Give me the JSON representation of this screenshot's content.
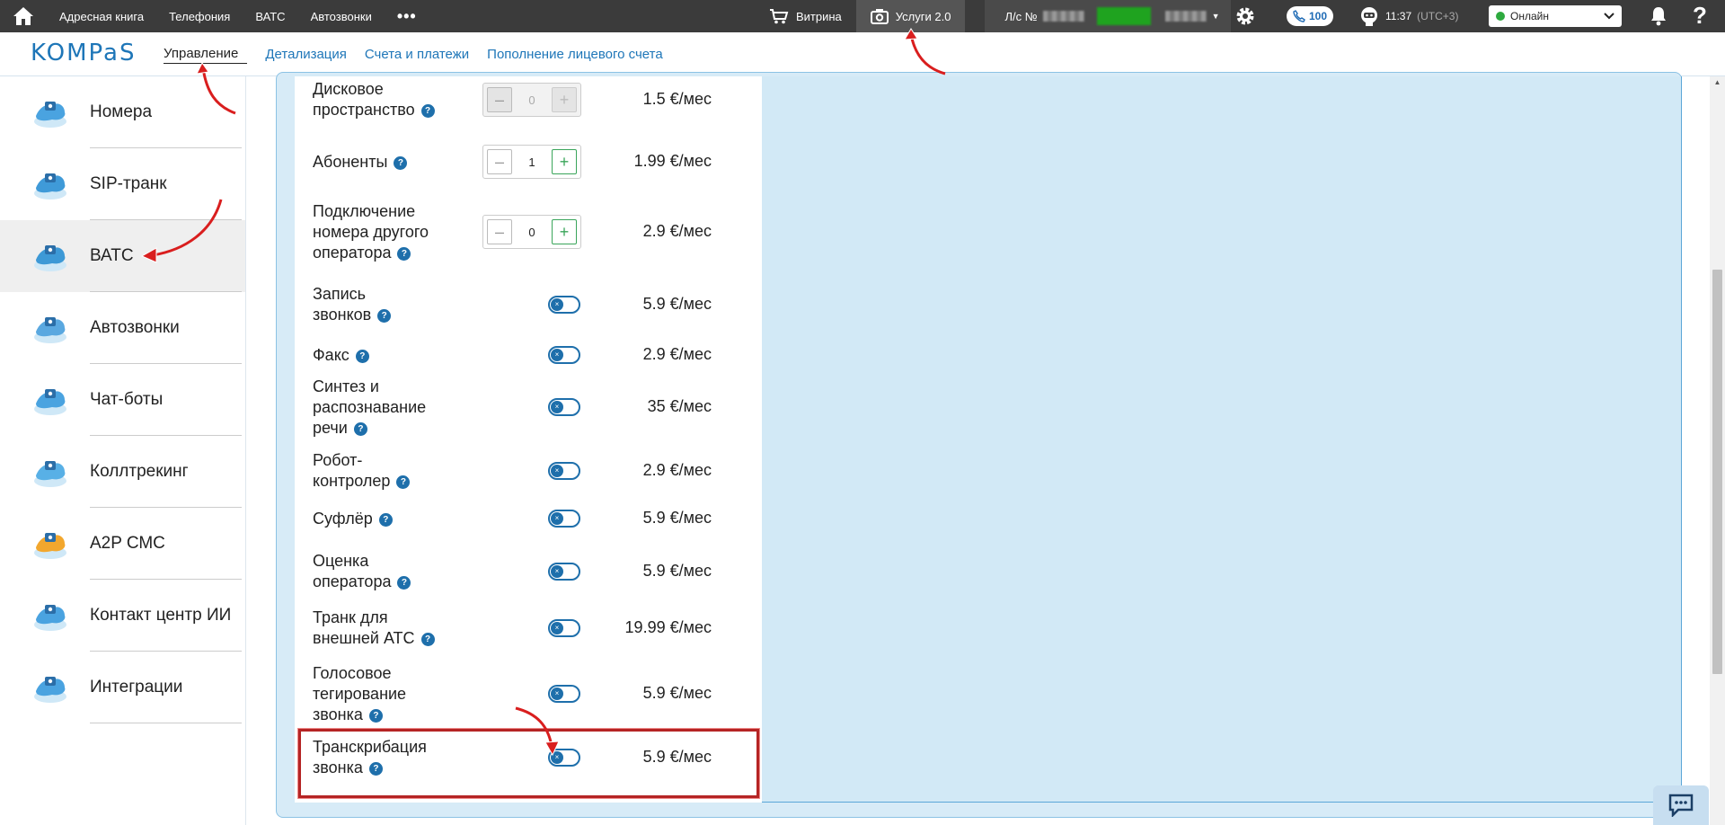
{
  "topbar": {
    "nav": [
      "Адресная книга",
      "Телефония",
      "ВАТС",
      "Автозвонки"
    ],
    "more": "•••",
    "vitrina": "Витрина",
    "services": "Услуги 2.0",
    "account_prefix": "Л/с №",
    "calls_count": "100",
    "time": "11:37",
    "timezone": "(UTC+3)",
    "status": "Онлайн",
    "help": "?"
  },
  "subheader": {
    "logo": "KOMPaS",
    "tabs": [
      "Управление",
      "Детализация",
      "Счета и платежи",
      "Пополнение лицевого счета"
    ]
  },
  "sidebar": {
    "items": [
      {
        "label": "Номера"
      },
      {
        "label": "SIP-транк"
      },
      {
        "label": "ВАТС"
      },
      {
        "label": "Автозвонки"
      },
      {
        "label": "Чат-боты"
      },
      {
        "label": "Коллтрекинг"
      },
      {
        "label": "A2P СМС"
      },
      {
        "label": "Контакт центр ИИ"
      },
      {
        "label": "Интеграции"
      }
    ],
    "active_index": 2
  },
  "services": [
    {
      "name": [
        "Дисковое",
        "пространство"
      ],
      "control": "stepper",
      "value": "0",
      "disabled": true,
      "price": "1.5 €/мес"
    },
    {
      "name": [
        "Абоненты"
      ],
      "control": "stepper",
      "value": "1",
      "disabled": false,
      "price": "1.99 €/мес"
    },
    {
      "name": [
        "Подключение",
        "номера другого",
        "оператора"
      ],
      "control": "stepper",
      "value": "0",
      "disabled": false,
      "price": "2.9 €/мес"
    },
    {
      "name": [
        "Запись",
        "звонков"
      ],
      "control": "toggle",
      "on": false,
      "price": "5.9 €/мес"
    },
    {
      "name": [
        "Факс"
      ],
      "control": "toggle",
      "on": false,
      "price": "2.9 €/мес"
    },
    {
      "name": [
        "Синтез и",
        "распознавание",
        "речи"
      ],
      "control": "toggle",
      "on": false,
      "price": "35 €/мес"
    },
    {
      "name": [
        "Робот-",
        "контролер"
      ],
      "control": "toggle",
      "on": false,
      "price": "2.9 €/мес"
    },
    {
      "name": [
        "Суфлёр"
      ],
      "control": "toggle",
      "on": false,
      "price": "5.9 €/мес"
    },
    {
      "name": [
        "Оценка",
        "оператора"
      ],
      "control": "toggle",
      "on": false,
      "price": "5.9 €/мес"
    },
    {
      "name": [
        "Транк для",
        "внешней АТС"
      ],
      "control": "toggle",
      "on": false,
      "price": "19.99 €/мес"
    },
    {
      "name": [
        "Голосовое",
        "тегирование",
        "звонка"
      ],
      "control": "toggle",
      "on": false,
      "price": "5.9 €/мес"
    },
    {
      "name": [
        "Транскрибация",
        "звонка"
      ],
      "control": "toggle",
      "on": false,
      "price": "5.9 €/мес",
      "highlighted": true
    }
  ],
  "colors": {
    "topbar": "#3b3b3b",
    "accent": "#1e76b8",
    "panel": "#d7ebf7",
    "highlight": "#b52424",
    "plus": "#3aa55a"
  }
}
